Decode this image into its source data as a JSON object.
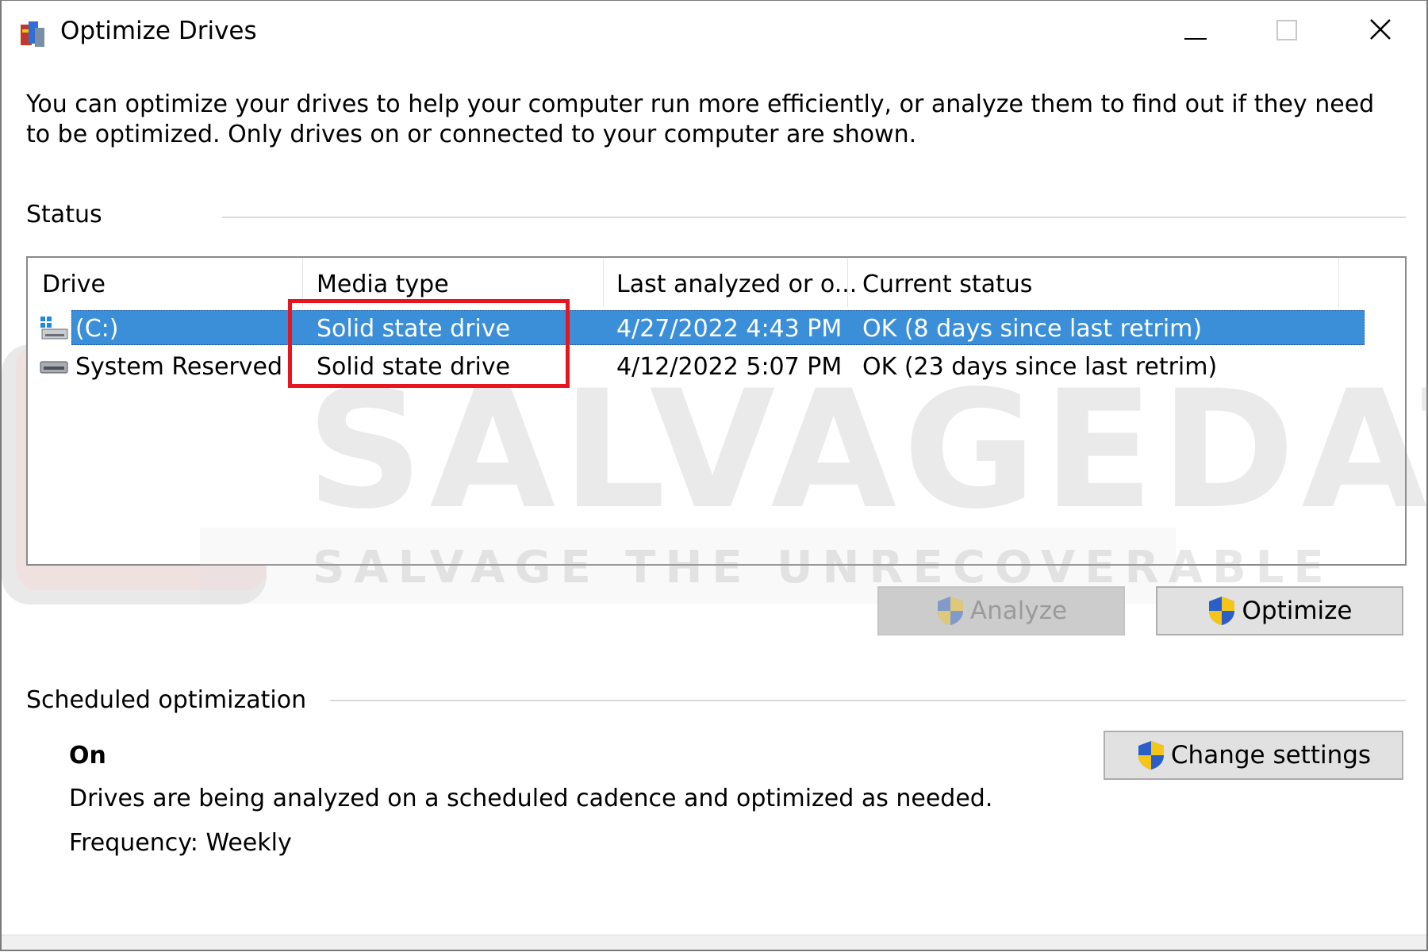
{
  "window": {
    "title": "Optimize Drives",
    "app_icon": "defrag-app-icon",
    "controls": {
      "minimize": "minimize-icon",
      "maximize": "maximize-icon",
      "close": "close-icon"
    }
  },
  "intro_text": "You can optimize your drives to help your computer run more efficiently, or analyze them to find out if they need to be optimized. Only drives on or connected to your computer are shown.",
  "status_section": {
    "label": "Status",
    "columns": [
      "Drive",
      "Media type",
      "Last analyzed or o...",
      "Current status"
    ],
    "rows": [
      {
        "drive": "(C:)",
        "icon": "system-drive-icon",
        "media_type": "Solid state drive",
        "last_analyzed": "4/27/2022 4:43 PM",
        "current_status": "OK (8 days since last retrim)",
        "selected": true
      },
      {
        "drive": "System Reserved",
        "icon": "drive-icon",
        "media_type": "Solid state drive",
        "last_analyzed": "4/12/2022 5:07 PM",
        "current_status": "OK (23 days since last retrim)",
        "selected": false
      }
    ],
    "analyze_button": "Analyze",
    "optimize_button": "Optimize"
  },
  "scheduled_section": {
    "label": "Scheduled optimization",
    "state": "On",
    "description": "Drives are being analyzed on a scheduled cadence and optimized as needed.",
    "frequency": "Frequency: Weekly",
    "change_settings_button": "Change settings"
  },
  "watermark": {
    "brand": "SALVAGEDATA",
    "tagline": "SALVAGE THE UNRECOVERABLE"
  },
  "colors": {
    "selection": "#3b8fd9",
    "highlight_box": "#e8141e",
    "shield_blue": "#2a5ec9",
    "shield_yellow": "#f5c518"
  }
}
